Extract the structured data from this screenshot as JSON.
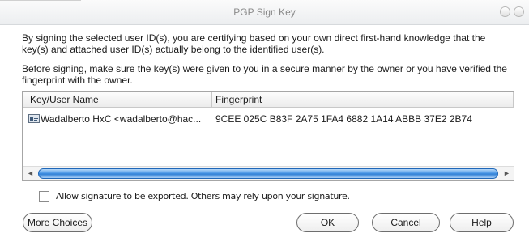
{
  "window": {
    "title": "PGP Sign Key"
  },
  "description": {
    "para1": "By signing the selected user ID(s), you are certifying based on your own direct first-hand knowledge that the key(s) and attached user ID(s) actually belong to the identified user(s).",
    "para2": "Before signing, make sure the key(s) were given to you in a secure manner by the owner or you have verified the fingerprint with the owner."
  },
  "key_list": {
    "columns": [
      "Key/User Name",
      "Fingerprint"
    ],
    "rows": [
      {
        "name": "Wadalberto HxC <wadalberto@hac...",
        "fingerprint": "9CEE 025C B83F 2A75 1FA4  6882 1A14 ABBB 37E2 2B74",
        "icon": "key-user-icon"
      }
    ],
    "scrollbar": {
      "left_arrow": "◄",
      "right_arrow": "►"
    }
  },
  "export_option": {
    "label": "Allow signature to be exported.  Others may rely upon your signature.",
    "checked": false
  },
  "buttons": {
    "more_choices": "More Choices",
    "ok": "OK",
    "cancel": "Cancel",
    "help": "Help"
  }
}
